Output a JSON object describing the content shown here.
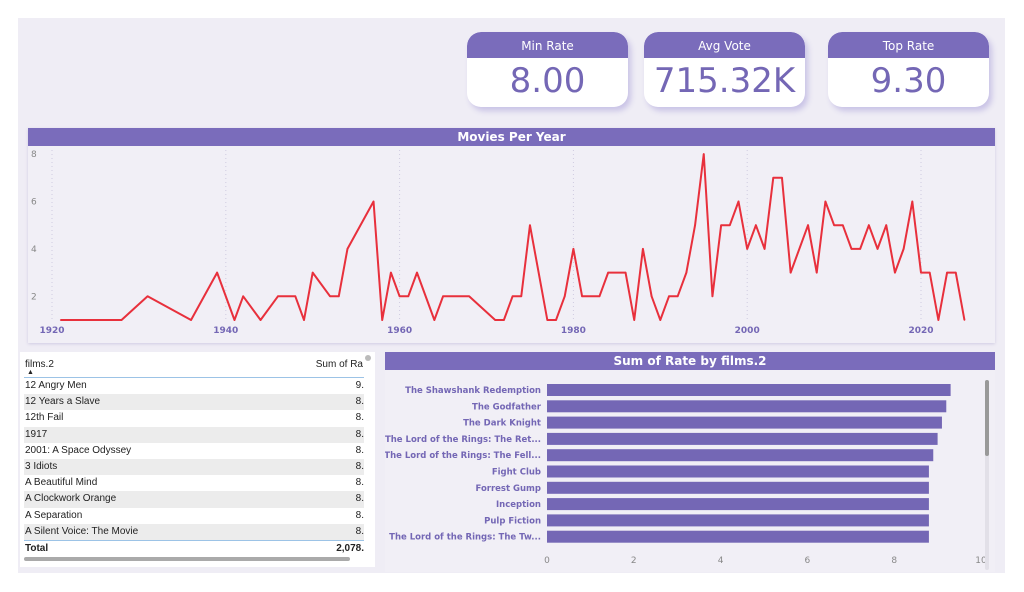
{
  "kpis": [
    {
      "label": "Min Rate",
      "value": "8.00"
    },
    {
      "label": "Avg Vote",
      "value": "715.32K"
    },
    {
      "label": "Top Rate",
      "value": "9.30"
    }
  ],
  "colors": {
    "accent": "#7a6cbb",
    "line": "#e8303c",
    "bar": "#7467b5"
  },
  "chart_data": [
    {
      "type": "line",
      "title": "Movies Per Year",
      "xlim": [
        1920,
        2025
      ],
      "ylim": [
        1,
        8
      ],
      "xticks": [
        "1920",
        "1940",
        "1960",
        "1980",
        "2000",
        "2020"
      ],
      "yticks": [
        "2",
        "4",
        "6",
        "8"
      ],
      "grid": "vertical dotted",
      "x": [
        1921,
        1928,
        1931,
        1936,
        1939,
        1941,
        1942,
        1944,
        1946,
        1948,
        1949,
        1950,
        1952,
        1953,
        1954,
        1957,
        1958,
        1959,
        1960,
        1961,
        1962,
        1964,
        1965,
        1968,
        1971,
        1972,
        1973,
        1974,
        1975,
        1977,
        1978,
        1979,
        1980,
        1981,
        1983,
        1984,
        1986,
        1987,
        1988,
        1989,
        1990,
        1991,
        1992,
        1993,
        1994,
        1995,
        1996,
        1997,
        1998,
        1999,
        2000,
        2001,
        2002,
        2003,
        2004,
        2005,
        2007,
        2008,
        2009,
        2010,
        2011,
        2012,
        2013,
        2014,
        2015,
        2016,
        2017,
        2018,
        2019,
        2020,
        2021,
        2022,
        2023,
        2024,
        2025
      ],
      "y": [
        1,
        1,
        2,
        1,
        3,
        1,
        2,
        1,
        2,
        2,
        1,
        3,
        2,
        2,
        4,
        6,
        1,
        3,
        2,
        2,
        3,
        1,
        2,
        2,
        1,
        1,
        2,
        2,
        5,
        1,
        1,
        2,
        4,
        2,
        2,
        3,
        3,
        1,
        4,
        2,
        1,
        2,
        2,
        3,
        5,
        8,
        2,
        5,
        5,
        6,
        4,
        5,
        4,
        7,
        7,
        3,
        5,
        3,
        6,
        5,
        5,
        4,
        4,
        5,
        4,
        5,
        3,
        4,
        6,
        3,
        3,
        1,
        3,
        3,
        1
      ]
    },
    {
      "type": "bar",
      "orientation": "horizontal",
      "title": "Sum of Rate by films.2",
      "xlim": [
        0,
        10
      ],
      "xticks": [
        "0",
        "2",
        "4",
        "6",
        "8",
        "10"
      ],
      "categories": [
        "The Shawshank Redemption",
        "The Godfather",
        "The Dark Knight",
        "The Lord of the Rings: The Ret...",
        "The Lord of the Rings: The Fell...",
        "Fight Club",
        "Forrest Gump",
        "Inception",
        "Pulp Fiction",
        "The Lord of the Rings: The Tw..."
      ],
      "values": [
        9.3,
        9.2,
        9.1,
        9.0,
        8.9,
        8.8,
        8.8,
        8.8,
        8.8,
        8.8
      ]
    }
  ],
  "table": {
    "headers": [
      "films.2",
      "Sum of Ra"
    ],
    "rows": [
      [
        "12 Angry Men",
        "9."
      ],
      [
        "12 Years a Slave",
        "8."
      ],
      [
        "12th Fail",
        "8."
      ],
      [
        "1917",
        "8."
      ],
      [
        "2001: A Space Odyssey",
        "8."
      ],
      [
        "3 Idiots",
        "8."
      ],
      [
        "A Beautiful Mind",
        "8."
      ],
      [
        "A Clockwork Orange",
        "8."
      ],
      [
        "A Separation",
        "8."
      ],
      [
        "A Silent Voice: The Movie",
        "8."
      ]
    ],
    "total_label": "Total",
    "total_value": "2,078."
  }
}
